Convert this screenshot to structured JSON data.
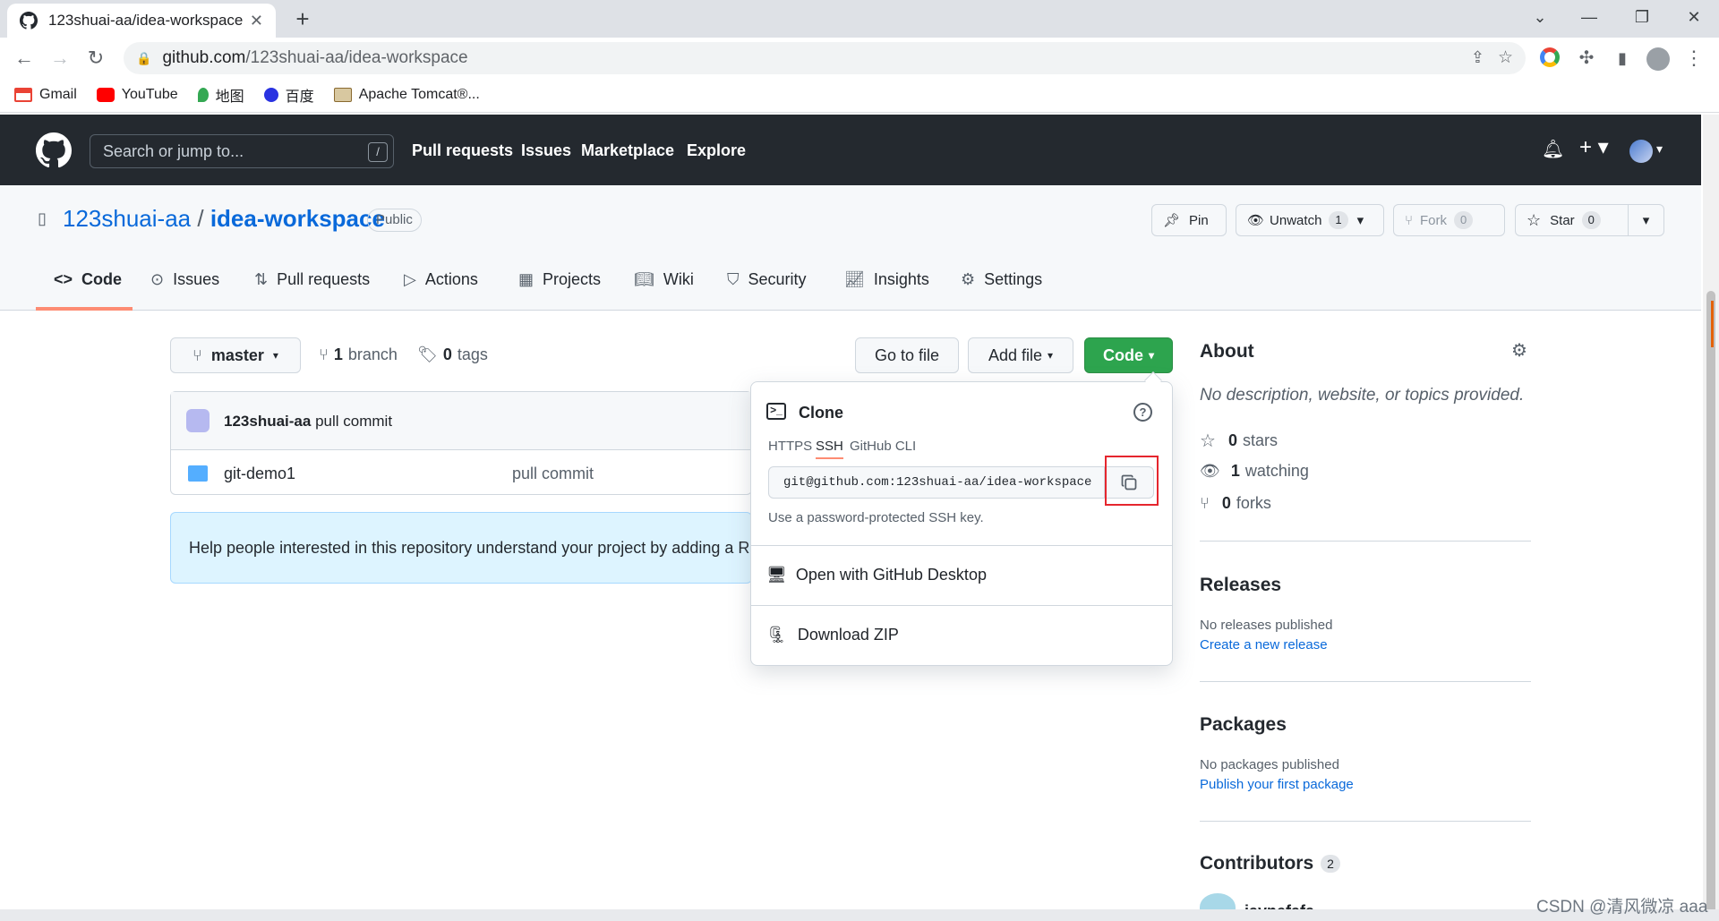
{
  "browser": {
    "tab_title": "123shuai-aa/idea-workspace",
    "url_host": "github.com",
    "url_path": "/123shuai-aa/idea-workspace",
    "bookmarks": [
      "Gmail",
      "YouTube",
      "地图",
      "百度",
      "Apache Tomcat®..."
    ]
  },
  "header": {
    "search_placeholder": "Search or jump to...",
    "slash": "/",
    "nav": [
      "Pull requests",
      "Issues",
      "Marketplace",
      "Explore"
    ]
  },
  "repo": {
    "owner": "123shuai-aa",
    "sep": "/",
    "name": "idea-workspace",
    "visibility": "Public",
    "pin": "Pin",
    "unwatch": "Unwatch",
    "watch_count": "1",
    "fork": "Fork",
    "fork_count": "0",
    "star": "Star",
    "star_count": "0",
    "tabs": [
      "Code",
      "Issues",
      "Pull requests",
      "Actions",
      "Projects",
      "Wiki",
      "Security",
      "Insights",
      "Settings"
    ]
  },
  "main": {
    "branch": "master",
    "branch_count": "1",
    "branch_label": "branch",
    "tag_count": "0",
    "tag_label": "tags",
    "go_to_file": "Go to file",
    "add_file": "Add file",
    "code": "Code",
    "commit_author": "123shuai-aa",
    "commit_msg": "pull commit",
    "file_name": "git-demo1",
    "file_commit": "pull commit",
    "help_text": "Help people interested in this repository understand your project by adding a README."
  },
  "clone": {
    "title": "Clone",
    "tabs": [
      "HTTPS",
      "SSH",
      "GitHub CLI"
    ],
    "active_tab": "SSH",
    "url": "git@github.com:123shuai-aa/idea-workspace",
    "hint": "Use a password-protected SSH key.",
    "desktop": "Open with GitHub Desktop",
    "zip": "Download ZIP"
  },
  "sidebar": {
    "about": "About",
    "desc": "No description, website, or topics provided.",
    "stars_n": "0",
    "stars": "stars",
    "watch_n": "1",
    "watch": "watching",
    "forks_n": "0",
    "forks": "forks",
    "releases": "Releases",
    "no_releases": "No releases published",
    "create_release": "Create a new release",
    "packages": "Packages",
    "no_packages": "No packages published",
    "publish_pkg": "Publish your first package",
    "contributors": "Contributors",
    "contrib_count": "2",
    "contrib_name": "jaynefafa"
  },
  "watermark": "CSDN @清风微凉 aaa"
}
